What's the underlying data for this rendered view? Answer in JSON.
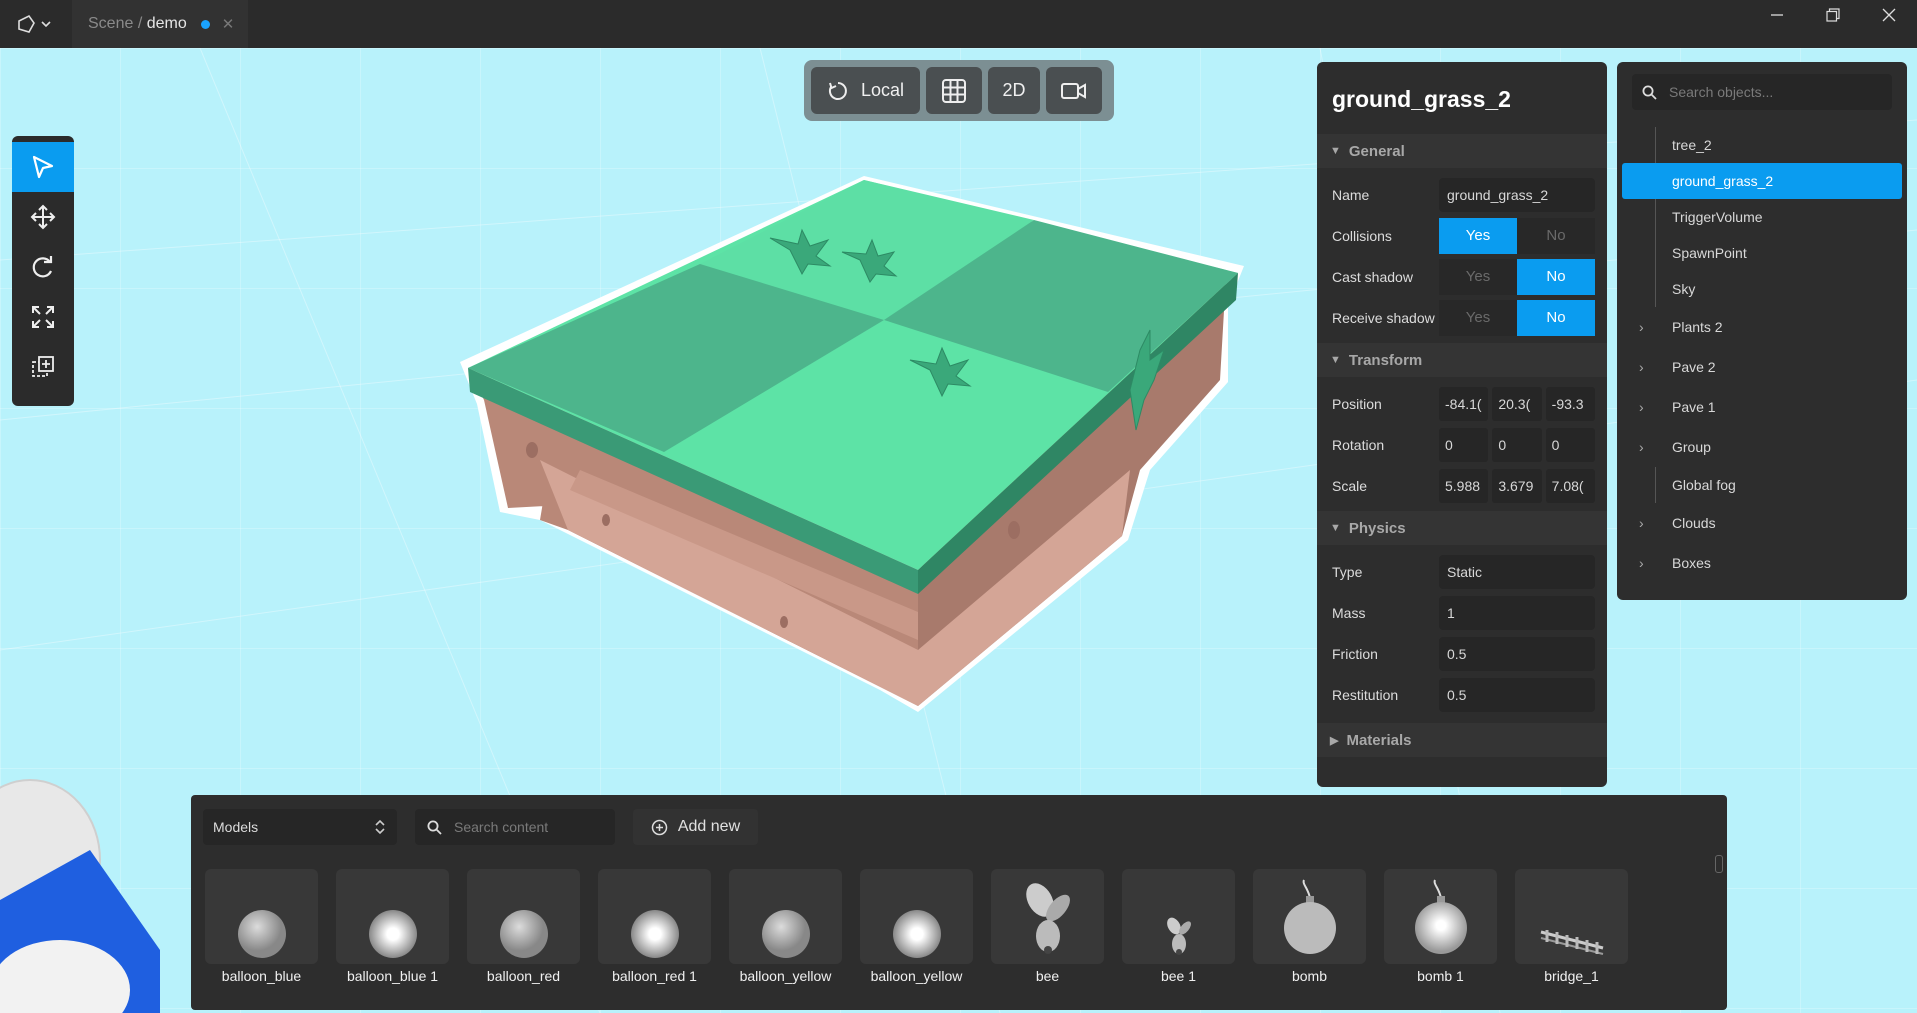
{
  "app": {
    "tab_scene": "Scene",
    "tab_sep": " / ",
    "tab_name": "demo",
    "menu_icon": "app-logo-icon"
  },
  "toolbar": {
    "local_label": "Local",
    "mode_2d_label": "2D"
  },
  "tools": [
    "select-tool-icon",
    "move-tool-icon",
    "rotate-tool-icon",
    "scale-tool-icon",
    "add-box-tool-icon"
  ],
  "properties": {
    "title": "ground_grass_2",
    "sections": {
      "general": "General",
      "transform": "Transform",
      "physics": "Physics",
      "materials": "Materials"
    },
    "general": {
      "name_label": "Name",
      "name_value": "ground_grass_2",
      "collisions_label": "Collisions",
      "cast_shadow_label": "Cast shadow",
      "receive_shadow_label": "Receive shadow",
      "yes": "Yes",
      "no": "No"
    },
    "transform": {
      "position_label": "Position",
      "position": [
        "-84.1(",
        "20.3(",
        "-93.3"
      ],
      "rotation_label": "Rotation",
      "rotation": [
        "0",
        "0",
        "0"
      ],
      "scale_label": "Scale",
      "scale": [
        "5.988",
        "3.679",
        "7.08("
      ]
    },
    "physics": {
      "type_label": "Type",
      "type_value": "Static",
      "mass_label": "Mass",
      "mass_value": "1",
      "friction_label": "Friction",
      "friction_value": "0.5",
      "restitution_label": "Restitution",
      "restitution_value": "0.5"
    }
  },
  "outliner": {
    "search_placeholder": "Search objects...",
    "items": [
      {
        "label": "tree_2"
      },
      {
        "label": "ground_grass_2"
      },
      {
        "label": "TriggerVolume"
      },
      {
        "label": "SpawnPoint"
      },
      {
        "label": "Sky"
      },
      {
        "label": "Plants 2"
      },
      {
        "label": "Pave 2"
      },
      {
        "label": "Pave 1"
      },
      {
        "label": "Group"
      },
      {
        "label": "Global fog"
      },
      {
        "label": "Clouds"
      },
      {
        "label": "Boxes"
      }
    ]
  },
  "content": {
    "category": "Models",
    "search_placeholder": "Search content",
    "add_label": "Add new",
    "items": [
      {
        "label": "balloon_blue"
      },
      {
        "label": "balloon_blue 1"
      },
      {
        "label": "balloon_red"
      },
      {
        "label": "balloon_red 1"
      },
      {
        "label": "balloon_yellow"
      },
      {
        "label": "balloon_yellow"
      },
      {
        "label": "bee"
      },
      {
        "label": "bee 1"
      },
      {
        "label": "bomb"
      },
      {
        "label": "bomb 1"
      },
      {
        "label": "bridge_1"
      }
    ]
  },
  "colors": {
    "accent": "#0a9cf0",
    "sky": "#b8f2fb",
    "panel": "#2d2d2d",
    "grass_light": "#5de3a6",
    "grass_dark": "#4db58c",
    "dirt": "#c49484"
  }
}
